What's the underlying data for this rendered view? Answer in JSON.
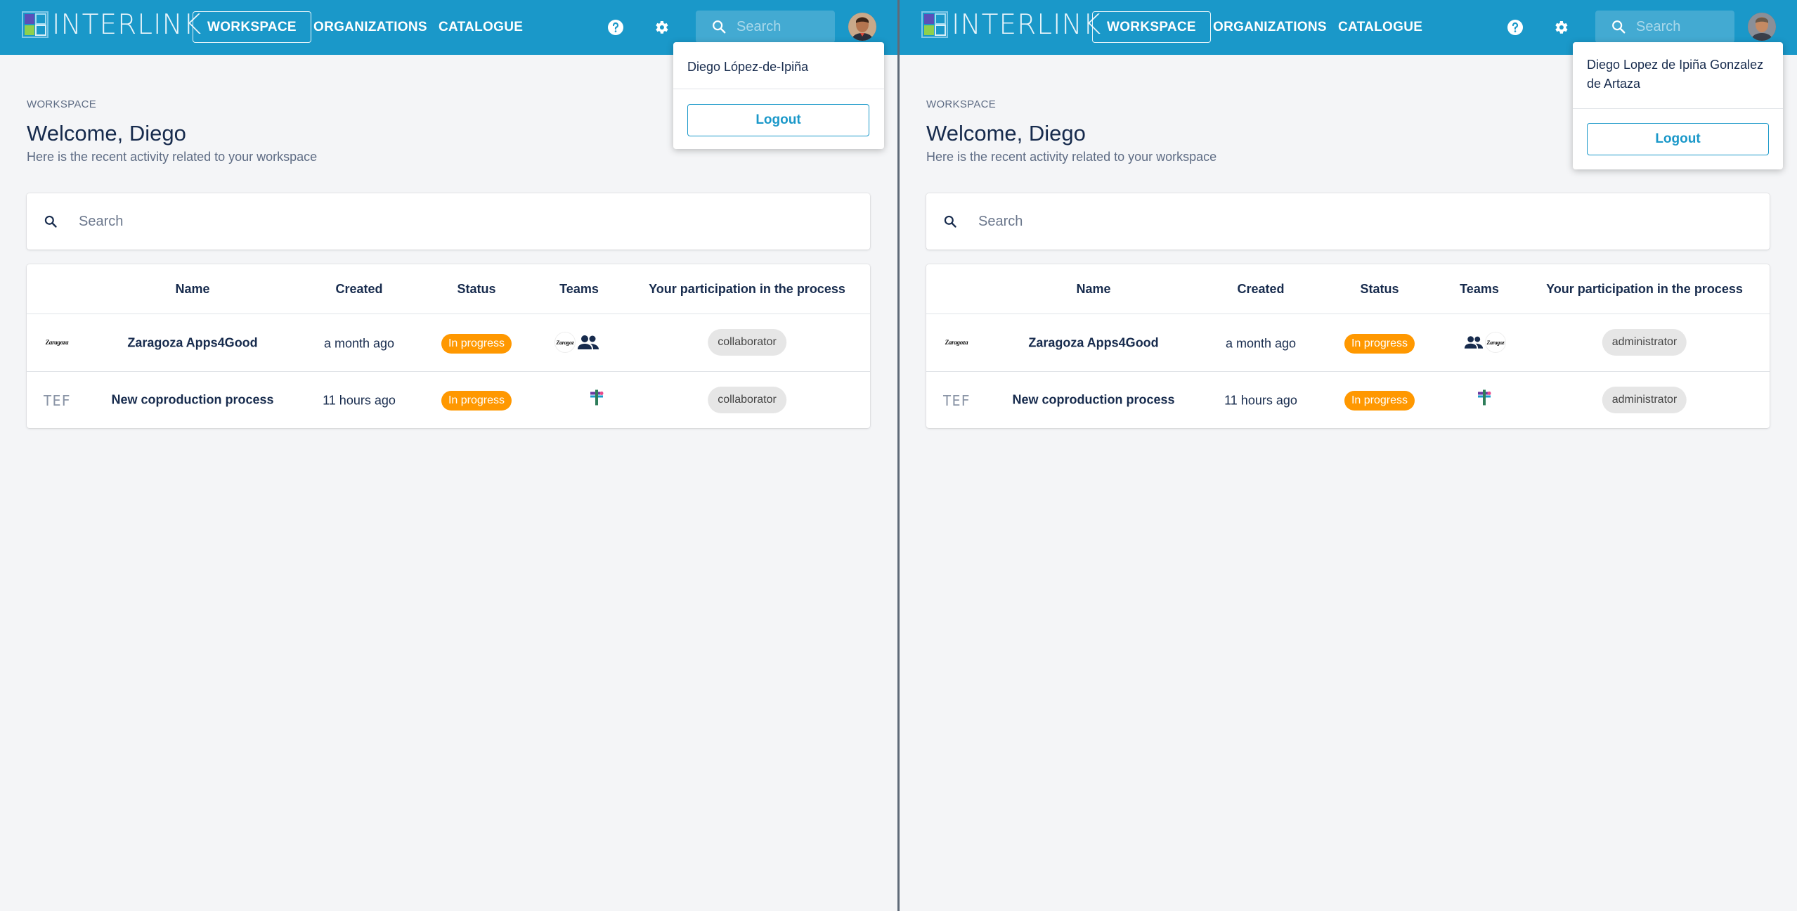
{
  "brand": {
    "logo_text": "INTERLINK"
  },
  "colors": {
    "topbar": "#1a98c9",
    "status_in_progress": "#ff9800",
    "chip_bg": "#e6e6e6"
  },
  "panes": [
    {
      "nav": {
        "workspace": "WORKSPACE",
        "organizations": "ORGANIZATIONS",
        "catalogue": "CATALOGUE"
      },
      "icons": {
        "help": "help-icon",
        "settings": "gear-icon",
        "search": "search-icon"
      },
      "top_search_placeholder": "Search",
      "breadcrumb": "WORKSPACE",
      "welcome": "Welcome, Diego",
      "subtitle": "Here is the recent activity related to your workspace",
      "search_placeholder": "Search",
      "table": {
        "headers": [
          "Name",
          "Created",
          "Status",
          "Teams",
          "Your participation in the process"
        ],
        "rows": [
          {
            "logo_text": "Zaragoza",
            "name": "Zaragoza Apps4Good",
            "created": "a month ago",
            "status": "In progress",
            "participation": "collaborator"
          },
          {
            "logo_text": "TEF",
            "name": "New coproduction process",
            "created": "11 hours ago",
            "status": "In progress",
            "participation": "collaborator"
          }
        ]
      },
      "user_menu": {
        "name": "Diego López-de-Ipiña",
        "logout": "Logout"
      }
    },
    {
      "nav": {
        "workspace": "WORKSPACE",
        "organizations": "ORGANIZATIONS",
        "catalogue": "CATALOGUE"
      },
      "icons": {
        "help": "help-icon",
        "settings": "gear-icon",
        "search": "search-icon"
      },
      "top_search_placeholder": "Search",
      "breadcrumb": "WORKSPACE",
      "welcome": "Welcome, Diego",
      "subtitle": "Here is the recent activity related to your workspace",
      "search_placeholder": "Search",
      "table": {
        "headers": [
          "Name",
          "Created",
          "Status",
          "Teams",
          "Your participation in the process"
        ],
        "rows": [
          {
            "logo_text": "Zaragoza",
            "name": "Zaragoza Apps4Good",
            "created": "a month ago",
            "status": "In progress",
            "participation": "administrator"
          },
          {
            "logo_text": "TEF",
            "name": "New coproduction process",
            "created": "11 hours ago",
            "status": "In progress",
            "participation": "administrator"
          }
        ]
      },
      "user_menu": {
        "name_line1": "Diego Lopez de Ipiña Gonzalez",
        "name_line2": "de Artaza",
        "logout": "Logout"
      }
    }
  ]
}
